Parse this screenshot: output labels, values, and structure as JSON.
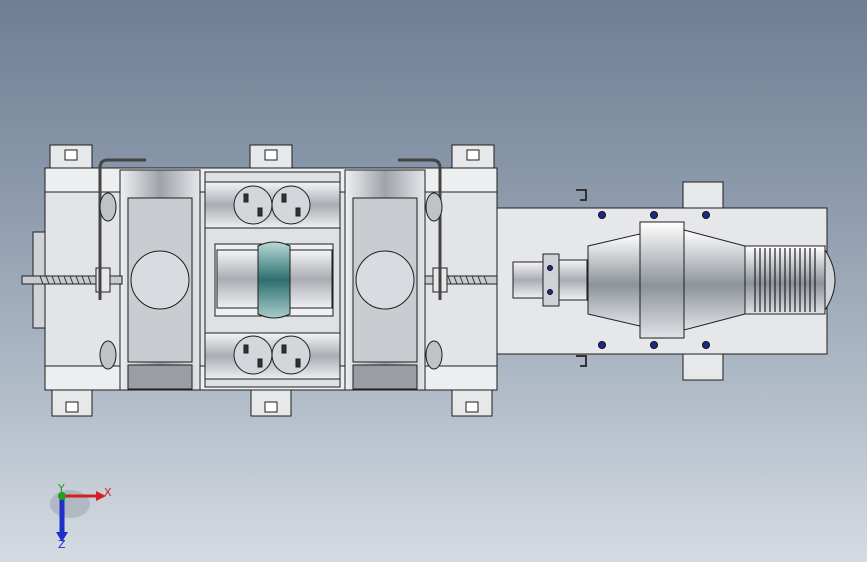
{
  "viewport": {
    "background_top": "#6f7f93",
    "background_bottom": "#d6dbe2",
    "model_steel": "#d9dce0",
    "model_edge": "#1e1e1e",
    "roll_tint": "#5fa3a3"
  },
  "triad": {
    "x_label": "X",
    "y_label": "Y",
    "z_label": "Z",
    "x_color": "#d42020",
    "y_color": "#1fa01f",
    "z_color": "#1d2fc4"
  },
  "icons": [
    "triad-icon"
  ]
}
